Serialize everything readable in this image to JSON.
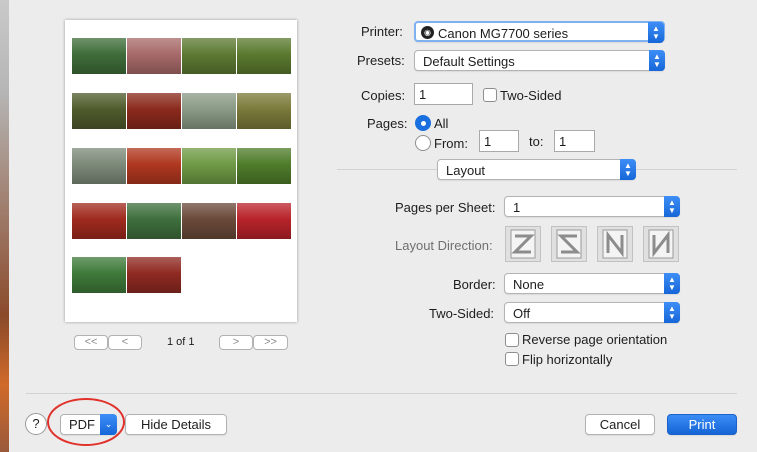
{
  "preview": {
    "page_indicator": "1 of 1",
    "nav": {
      "first": "<<",
      "prev": "<",
      "next": ">",
      "last": ">>"
    },
    "thumbnail_colors": [
      [
        "#3f6d3a",
        "#a86a6a",
        "#5d7a33",
        "#5b7a2f"
      ],
      [
        "#4f5b2c",
        "#8b2a1c",
        "#8a9a86",
        "#7b7a3a"
      ],
      [
        "#7d8a79",
        "#b0381f",
        "#6f9a45",
        "#4f7d2a"
      ],
      [
        "#a02a1e",
        "#3f6f3d",
        "#6a4a3a",
        "#b8232a"
      ],
      [
        "#3f7a3a",
        "#8f2a22"
      ]
    ]
  },
  "printer": {
    "label": "Printer:",
    "value": "Canon MG7700 series"
  },
  "presets": {
    "label": "Presets:",
    "value": "Default Settings"
  },
  "copies": {
    "label": "Copies:",
    "value": "1",
    "two_sided_label": "Two-Sided"
  },
  "pages": {
    "label": "Pages:",
    "all_label": "All",
    "from_label": "From:",
    "from_value": "1",
    "to_label": "to:",
    "to_value": "1"
  },
  "section": {
    "value": "Layout"
  },
  "layout": {
    "pages_per_sheet_label": "Pages per Sheet:",
    "pages_per_sheet_value": "1",
    "direction_label": "Layout Direction:",
    "border_label": "Border:",
    "border_value": "None",
    "two_sided_label": "Two-Sided:",
    "two_sided_value": "Off",
    "reverse_label": "Reverse page orientation",
    "flip_label": "Flip horizontally"
  },
  "footer": {
    "help_label": "?",
    "pdf_label": "PDF",
    "hide_details_label": "Hide Details",
    "cancel_label": "Cancel",
    "print_label": "Print"
  },
  "colors": {
    "accent": "#1a6fe0",
    "annotation_ring": "#e0312b"
  }
}
